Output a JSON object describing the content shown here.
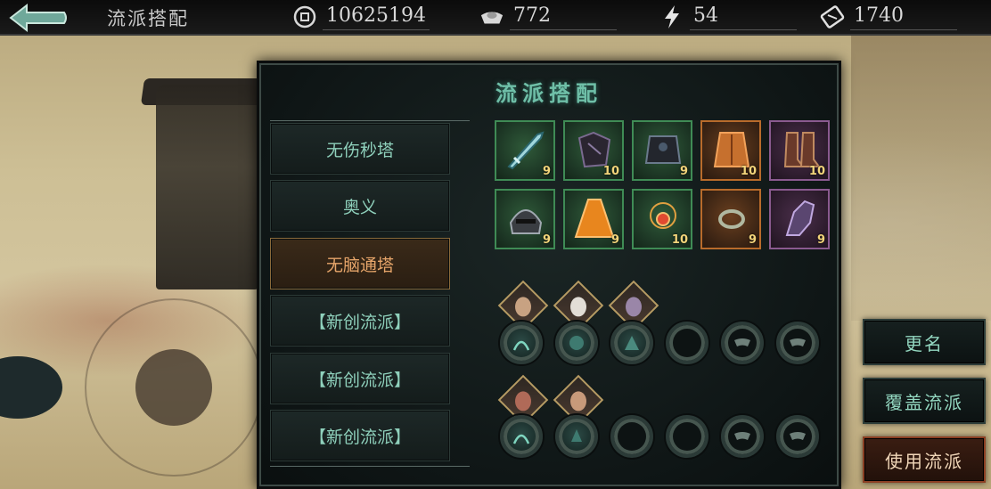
{
  "topbar": {
    "title": "流派搭配",
    "resources": [
      {
        "icon": "coin-icon",
        "value": "10625194"
      },
      {
        "icon": "silver-ingot-icon",
        "value": "772"
      },
      {
        "icon": "lightning-icon",
        "value": "54"
      },
      {
        "icon": "ticket-icon",
        "value": "1740"
      }
    ]
  },
  "panel": {
    "title": "流派搭配",
    "presets": [
      {
        "label": "无伤秒塔",
        "active": false
      },
      {
        "label": "奥义",
        "active": false
      },
      {
        "label": "无脑通塔",
        "active": true
      },
      {
        "label": "【新创流派】",
        "active": false
      },
      {
        "label": "【新创流派】",
        "active": false
      },
      {
        "label": "【新创流派】",
        "active": false
      }
    ],
    "equipment": [
      {
        "icon": "sword-icon",
        "level": "9",
        "rarity": "green"
      },
      {
        "icon": "dark-armor-icon",
        "level": "10",
        "rarity": "green"
      },
      {
        "icon": "chest-armor-icon",
        "level": "9",
        "rarity": "green"
      },
      {
        "icon": "orange-robe-icon",
        "level": "10",
        "rarity": "orange"
      },
      {
        "icon": "boots-icon",
        "level": "10",
        "rarity": "green"
      },
      {
        "icon": "helmet-icon",
        "level": "9",
        "rarity": "green"
      },
      {
        "icon": "cape-icon",
        "level": "9",
        "rarity": "green"
      },
      {
        "icon": "amulet-icon",
        "level": "10",
        "rarity": "green"
      },
      {
        "icon": "ring-icon",
        "level": "9",
        "rarity": "orange"
      },
      {
        "icon": "gauntlet-icon",
        "level": "9",
        "rarity": "purple"
      }
    ]
  },
  "skill_rows": [
    {
      "slots": [
        "filled",
        "filled",
        "filled",
        "empty",
        "lock",
        "lock"
      ],
      "portraits": 3
    },
    {
      "slots": [
        "filled",
        "filled",
        "empty",
        "empty",
        "lock",
        "lock"
      ],
      "portraits": 2
    }
  ],
  "actions": {
    "rename": "更名",
    "overwrite": "覆盖流派",
    "use": "使用流派"
  },
  "colors": {
    "accent_teal": "#8fd1bc",
    "active_orange": "#e6a56a",
    "level_gold": "#f2d47a"
  }
}
